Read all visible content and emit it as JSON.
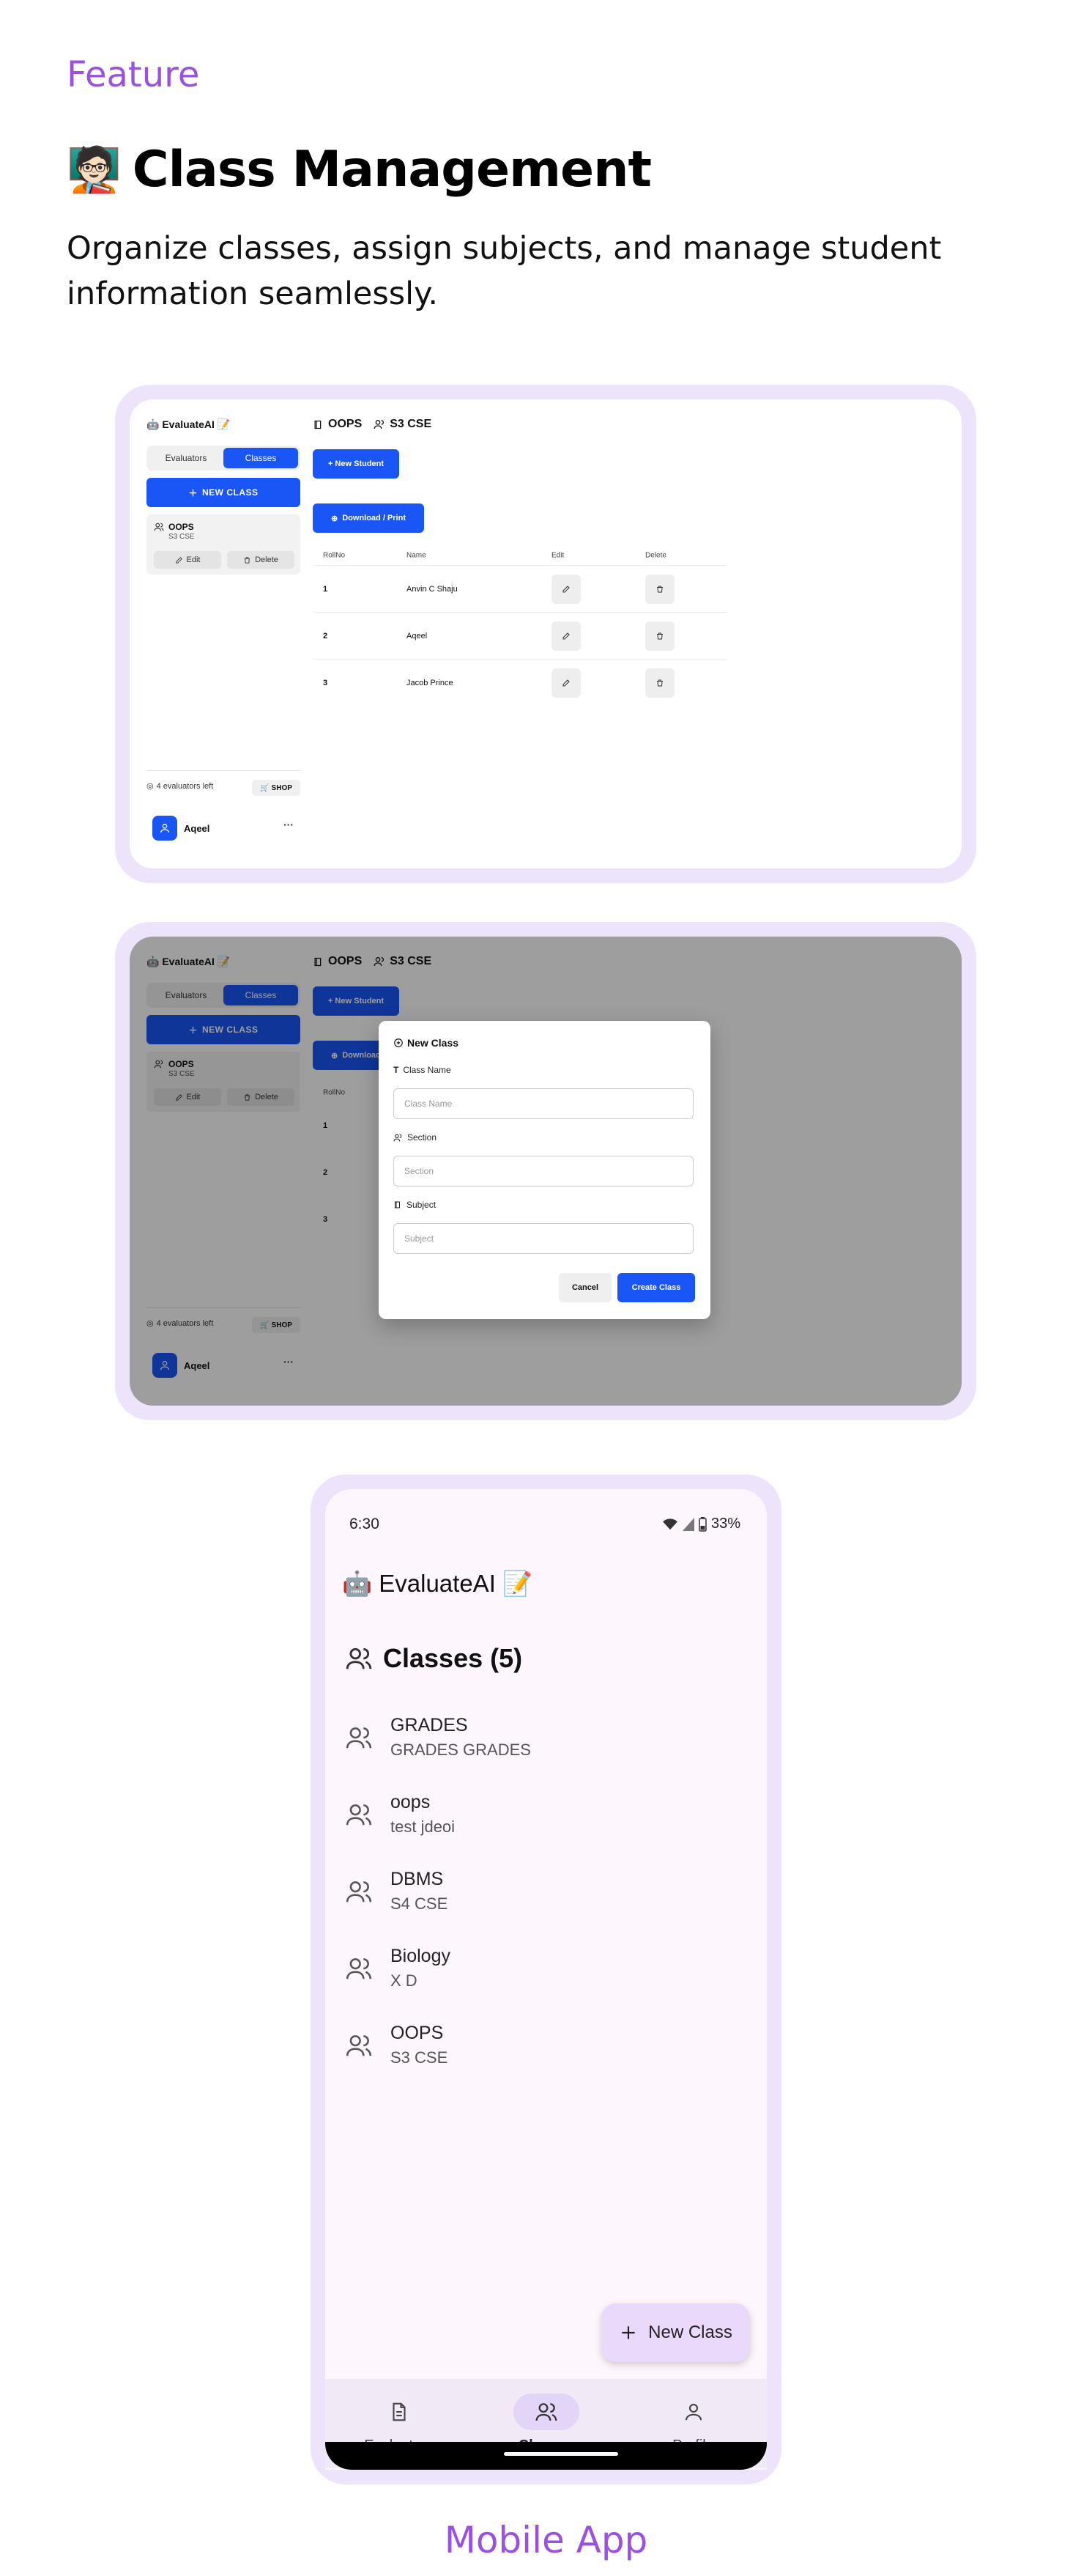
{
  "header": {
    "eyebrow": "Feature",
    "emoji": "🧑🏻‍🏫",
    "title": "Class Management",
    "description": "Organize classes, assign subjects, and manage student information seamlessly."
  },
  "desktop": {
    "logo": "🤖 EvaluateAI 📝",
    "tabs": [
      "Evaluators",
      "Classes"
    ],
    "active_tab": "Classes",
    "new_class_label": "NEW CLASS",
    "class_card": {
      "name": "OOPS",
      "section": "S3 CSE",
      "edit_label": "Edit",
      "delete_label": "Delete"
    },
    "credits": "4 evaluators left",
    "shop_label": "SHOP",
    "user_name": "Aqeel",
    "more": "···",
    "main": {
      "class_name": "OOPS",
      "section": "S3 CSE",
      "new_student_label": "+ New Student",
      "download_label": "Download / Print",
      "columns": [
        "RollNo",
        "Name",
        "Edit",
        "Delete"
      ],
      "students": [
        {
          "roll": "1",
          "name": "Anvin C Shaju"
        },
        {
          "roll": "2",
          "name": "Aqeel"
        },
        {
          "roll": "3",
          "name": "Jacob Prince"
        }
      ]
    },
    "dialog": {
      "title": "New Class",
      "fields": [
        {
          "label": "Class Name",
          "placeholder": "Class Name"
        },
        {
          "label": "Section",
          "placeholder": "Section"
        },
        {
          "label": "Subject",
          "placeholder": "Subject"
        }
      ],
      "cancel_label": "Cancel",
      "create_label": "Create Class"
    }
  },
  "mobile": {
    "time": "6:30",
    "battery": "33%",
    "app_title": "🤖 EvaluateAI 📝",
    "heading": "Classes (5)",
    "classes": [
      {
        "name": "GRADES",
        "section": "GRADES GRADES"
      },
      {
        "name": "oops",
        "section": "test jdeoi"
      },
      {
        "name": "DBMS",
        "section": "S4 CSE"
      },
      {
        "name": "Biology",
        "section": "X D"
      },
      {
        "name": "OOPS",
        "section": "S3 CSE"
      }
    ],
    "fab_label": "New Class",
    "nav": [
      {
        "label": "Evaluators",
        "icon": "document-icon"
      },
      {
        "label": "Classes",
        "icon": "users-icon"
      },
      {
        "label": "Profile",
        "icon": "person-icon"
      }
    ],
    "active_nav": "Classes"
  },
  "caption": "Mobile App",
  "colors": {
    "accent_purple": "#9b51e0",
    "primary_blue": "#1a56f5",
    "frame_lavender": "#ede4fb"
  }
}
